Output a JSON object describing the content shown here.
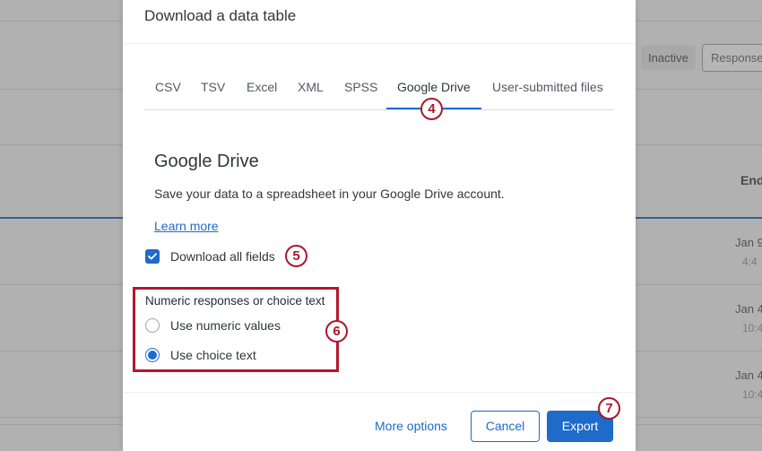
{
  "background": {
    "status_pill": "Inactive",
    "responses_button": "Responses",
    "column_header": "End",
    "rows": [
      {
        "date": "Jan 9",
        "time": "4:4"
      },
      {
        "date": "Jan 4",
        "time": "10:4"
      },
      {
        "date": "Jan 4",
        "time": "10:4"
      }
    ]
  },
  "modal": {
    "title": "Download a data table",
    "tabs": [
      {
        "label": "CSV",
        "active": false
      },
      {
        "label": "TSV",
        "active": false
      },
      {
        "label": "Excel",
        "active": false
      },
      {
        "label": "XML",
        "active": false
      },
      {
        "label": "SPSS",
        "active": false
      },
      {
        "label": "Google Drive",
        "active": true
      },
      {
        "label": "User-submitted files",
        "active": false
      }
    ],
    "section_title": "Google Drive",
    "description": "Save your data to a spreadsheet in your Google Drive account.",
    "learn_more": "Learn more",
    "download_all_fields": {
      "label": "Download all fields",
      "checked": true
    },
    "numeric_group": {
      "label": "Numeric responses or choice text",
      "options": [
        {
          "label": "Use numeric values",
          "selected": false
        },
        {
          "label": "Use choice text",
          "selected": true
        }
      ]
    },
    "footer": {
      "more_options": "More options",
      "cancel": "Cancel",
      "export": "Export"
    }
  },
  "annotations": {
    "step4": "4",
    "step5": "5",
    "step6": "6",
    "step7": "7"
  },
  "colors": {
    "accent": "#1e6bc9",
    "annotation": "#a8192e"
  }
}
